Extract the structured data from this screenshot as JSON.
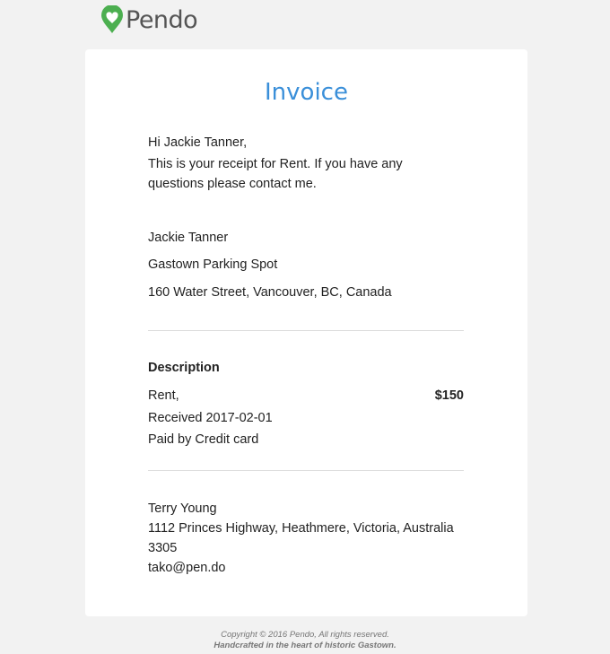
{
  "brand": {
    "name": "Pendo",
    "accent_color": "#3a8fd9",
    "logo_color": "#4caf50"
  },
  "invoice": {
    "title": "Invoice",
    "greeting": "Hi Jackie Tanner,",
    "message_line1": "This is your receipt for Rent. If you have any",
    "message_line2": "questions please contact me."
  },
  "recipient": {
    "name": "Jackie Tanner",
    "property": "Gastown Parking Spot",
    "address": "160 Water Street, Vancouver, BC, Canada"
  },
  "description": {
    "header": "Description",
    "item": "Rent,",
    "amount": "$150",
    "received": "Received 2017-02-01",
    "paid_by": "Paid by Credit card"
  },
  "sender": {
    "name": "Terry Young",
    "address_line1": "1112 Princes Highway, Heathmere, Victoria, Australia",
    "address_line2": "3305",
    "email": "tako@pen.do"
  },
  "footer": {
    "copyright": "Copyright © 2016 Pendo, All rights reserved.",
    "tagline": "Handcrafted in the heart of historic Gastown."
  }
}
